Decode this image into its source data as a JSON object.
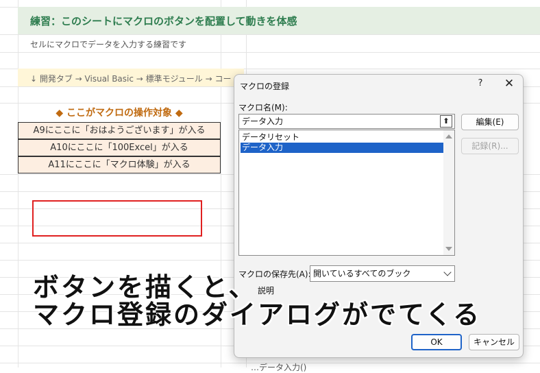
{
  "sheet": {
    "title": "練習：このシートにマクロのボタンを配置して動きを体感",
    "subtitle": "セルにマクロでデータを入力する練習です",
    "hint": "↓ 開発タブ → Visual Basic → 標準モジュール → コー",
    "target_title": "◆ ここがマクロの操作対象 ◆",
    "target_cells": [
      "A9にここに「おはようございます」が入る",
      "A10にここに「100Excel」が入る",
      "A11にここに「マクロ体験」が入る"
    ],
    "bottom_peek": "…データ入力()"
  },
  "dialog": {
    "title": "マクロの登録",
    "help": "?",
    "close": "✕",
    "macro_name_label": "マクロ名(M):",
    "macro_name_value": "データ入力",
    "up_symbol": "⬆",
    "macros": [
      {
        "label": "データリセット",
        "selected": false
      },
      {
        "label": "データ入力",
        "selected": true
      }
    ],
    "edit_button": "編集(E)",
    "record_button": "記録(R)...",
    "store_label": "マクロの保存先(A):",
    "store_value": "開いているすべてのブック",
    "description_label": "説明",
    "ok_button": "OK",
    "cancel_button": "キャンセル"
  },
  "caption": {
    "line1": "ボタンを描くと、",
    "line2": "マクロ登録のダイアログがでてくる"
  },
  "colors": {
    "title_green": "#2e7d4f",
    "target_orange": "#c06a10",
    "cell_fill": "#fdeee1",
    "red_outline": "#e02020",
    "selection_blue": "#1e63c8"
  }
}
